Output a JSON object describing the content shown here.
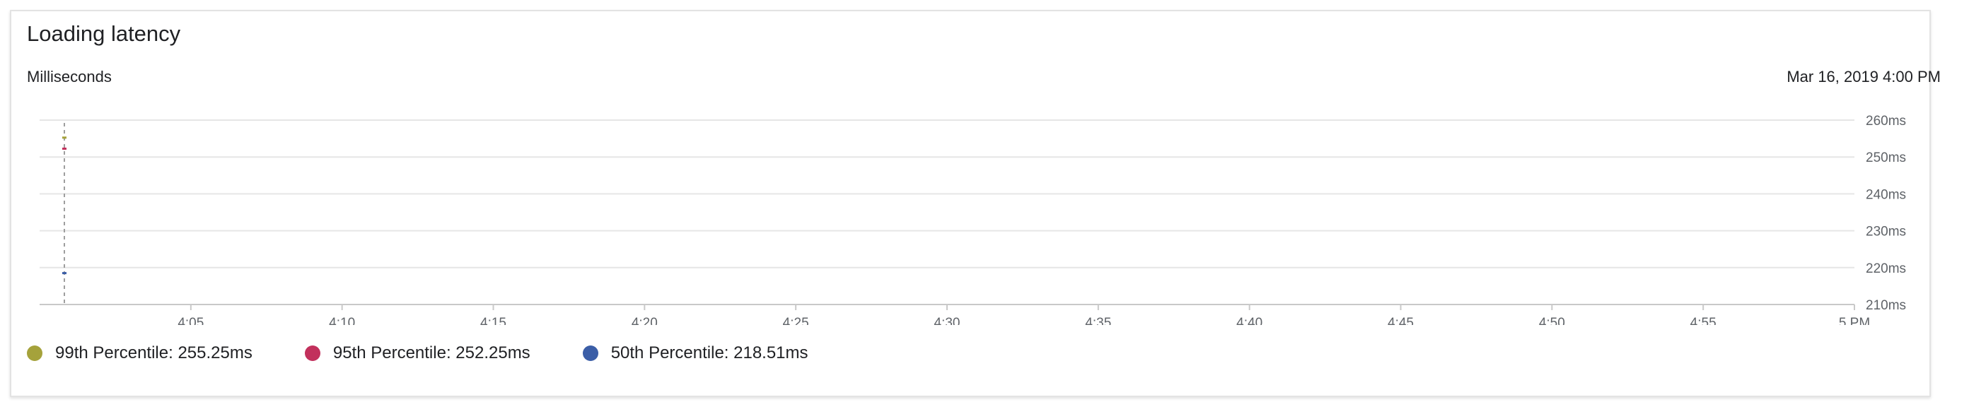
{
  "card": {
    "title": "Loading latency",
    "y_unit_label": "Milliseconds",
    "timestamp": "Mar 16, 2019 4:00 PM"
  },
  "chart_data": {
    "type": "line",
    "x_ticks": [
      "4:05",
      "4:10",
      "4:15",
      "4:20",
      "4:25",
      "4:30",
      "4:35",
      "4:40",
      "4:45",
      "4:50",
      "4:55",
      "5 PM"
    ],
    "x_range": [
      "4:00",
      "5 PM"
    ],
    "y_ticks": [
      "260ms",
      "250ms",
      "240ms",
      "230ms",
      "220ms",
      "210ms"
    ],
    "ylim": [
      210,
      260
    ],
    "grid": true,
    "cursor_time": "4:00",
    "series": [
      {
        "name": "99th Percentile",
        "color": "#a5a23b",
        "points": [
          {
            "x": "4:00",
            "y": 255.25
          }
        ]
      },
      {
        "name": "95th Percentile",
        "color": "#c2305c",
        "points": [
          {
            "x": "4:00",
            "y": 252.25
          }
        ]
      },
      {
        "name": "50th Percentile",
        "color": "#3b5ea7",
        "points": [
          {
            "x": "4:00",
            "y": 218.51
          }
        ]
      }
    ]
  },
  "legend": [
    {
      "label": "99th Percentile: 255.25ms",
      "color": "#a5a23b"
    },
    {
      "label": "95th Percentile: 252.25ms",
      "color": "#c2305c"
    },
    {
      "label": "50th Percentile: 218.51ms",
      "color": "#3b5ea7"
    }
  ]
}
